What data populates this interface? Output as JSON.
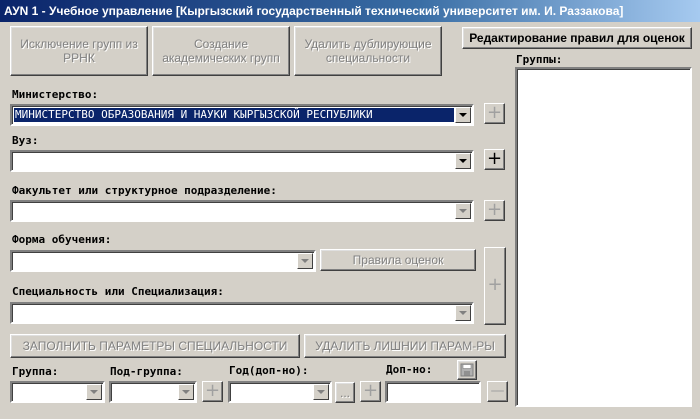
{
  "window": {
    "title": "АУN 1 - Учебное управление [Кыргызский государственный технический университет им. И. Раззакова]"
  },
  "toolbar": {
    "exclude_groups_label": "Исключение групп из РРНК",
    "create_groups_label": "Создание академических групп",
    "delete_duplicates_label": "Удалить дублирующие специальности",
    "edit_rules_label": "Редактирование правил для оценок"
  },
  "groups_panel": {
    "label": "Группы:"
  },
  "ministry": {
    "label": "Министерство:",
    "value": "МИНИСТЕРСТВО ОБРАЗОВАНИЯ И НАУКИ КЫРГЫЗСКОЙ РЕСПУБЛИКИ"
  },
  "university": {
    "label": "Вуз:",
    "value": ""
  },
  "faculty": {
    "label": "Факультет или структурное подразделение:",
    "value": ""
  },
  "study_form": {
    "label": "Форма обучения:",
    "value": ""
  },
  "grade_rules": {
    "label": "Правила оценок"
  },
  "specialty": {
    "label": "Специальность или Специализация:",
    "value": ""
  },
  "actions": {
    "fill_params_label": "ЗАПОЛНИТЬ ПАРАМЕТРЫ СПЕЦИАЛЬНОСТИ",
    "delete_params_label": "УДАЛИТЬ ЛИШНИИ ПАРАМ-РЫ"
  },
  "bottom": {
    "group_label": "Группа:",
    "subgroup_label": "Под-группа:",
    "year_label": "Год(доп-но):",
    "extra_label": "Доп-но:",
    "ellipsis_label": "...",
    "plus_glyph": "+",
    "minus_glyph": "—"
  },
  "colors": {
    "face": "#d4d0c8",
    "selection": "#0a246a",
    "title_start": "#0a246a",
    "title_end": "#a6caf0"
  }
}
